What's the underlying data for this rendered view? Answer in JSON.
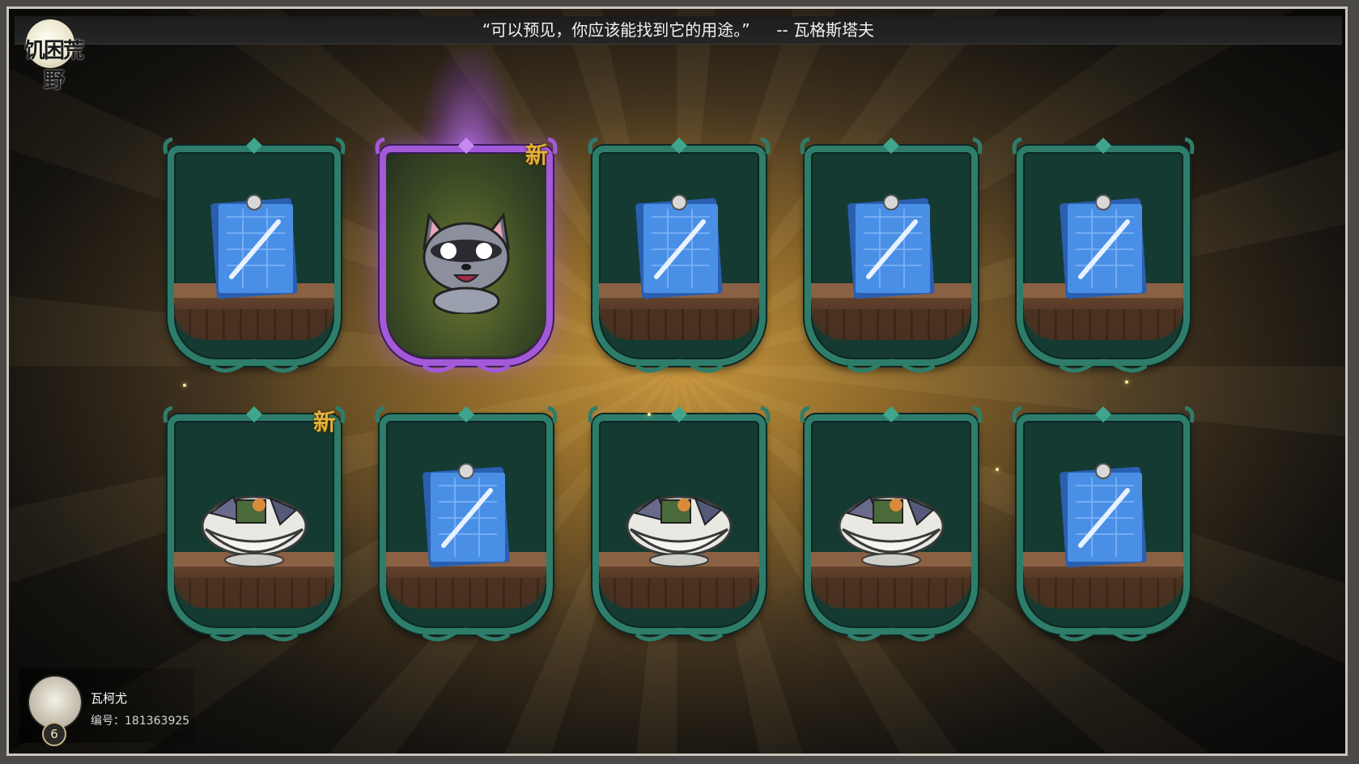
{
  "header": {
    "quote": "“可以预见，你应该能找到它的用途。”",
    "author": "-- 瓦格斯塔夫"
  },
  "logo": {
    "title": "饥困荒野"
  },
  "cards": [
    {
      "row": 1,
      "col": 1,
      "item": "blueprint",
      "new": false
    },
    {
      "row": 1,
      "col": 2,
      "item": "raccoon-skin",
      "new": true,
      "rarity": "purple"
    },
    {
      "row": 1,
      "col": 3,
      "item": "blueprint",
      "new": false
    },
    {
      "row": 1,
      "col": 4,
      "item": "blueprint",
      "new": false
    },
    {
      "row": 1,
      "col": 5,
      "item": "blueprint",
      "new": false
    },
    {
      "row": 2,
      "col": 1,
      "item": "bundle",
      "new": true
    },
    {
      "row": 2,
      "col": 2,
      "item": "blueprint",
      "new": false
    },
    {
      "row": 2,
      "col": 3,
      "item": "bundle",
      "new": false
    },
    {
      "row": 2,
      "col": 4,
      "item": "bundle",
      "new": false
    },
    {
      "row": 2,
      "col": 5,
      "item": "blueprint",
      "new": false
    }
  ],
  "new_badge": "新",
  "user": {
    "name": "瓦柯尤",
    "id_label": "编号：181363925",
    "level": "6"
  },
  "colors": {
    "card_border": "#2e7d6b",
    "rare_border": "#a35ad9",
    "new_badge": "#e3b23c",
    "blueprint": "#3b7fd9"
  }
}
